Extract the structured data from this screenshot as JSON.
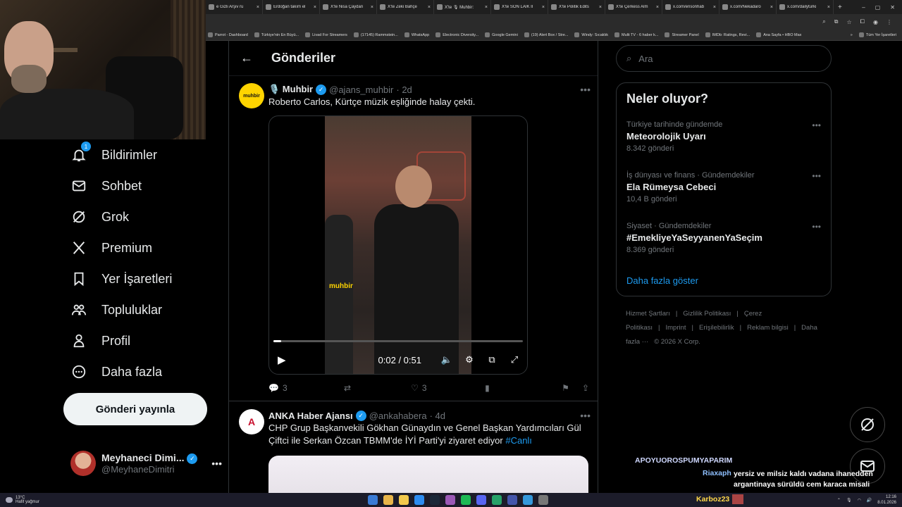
{
  "browser": {
    "tabs": [
      {
        "label": "e Gizli Arşiv ru"
      },
      {
        "label": "Erdoğan takım el"
      },
      {
        "label": "X'te Nisa Çaydan"
      },
      {
        "label": "X'te Zeki Bahçe"
      },
      {
        "label": "X'te 🎙 Muhbir:"
      },
      {
        "label": "X'te SON LAİK İl"
      },
      {
        "label": "X'te Politik Edits"
      },
      {
        "label": "X'te Çerkess Alm"
      },
      {
        "label": "x.com/ensonhab"
      },
      {
        "label": "x.com/Nekadaro"
      },
      {
        "label": "x.com/dailyturki"
      }
    ],
    "tab_close": "×",
    "new_tab": "+",
    "window_controls": [
      "–",
      "▢",
      "✕"
    ],
    "bookmarks": [
      "Parrot - Dashboard",
      "Türkiye'nin En Büyü...",
      "Livad For Streamers",
      "(17145) Rammstein...",
      "WhatsApp",
      "Electronic Diversity...",
      "Google Gemini",
      "(19) Alert Box / Stre...",
      "Windy: Sıcaklık",
      "Multi TV - 6 haber k...",
      "Streamer Panel",
      "IMDb: Ratings, Revi...",
      "Ana Sayfa • HBO Max"
    ],
    "bookmarks_more": "»",
    "bookmarks_all": "Tüm Yer İşaretleri"
  },
  "sidebar": {
    "items": [
      {
        "label": "Bildirimler",
        "icon": "bell-icon",
        "badge": "1"
      },
      {
        "label": "Sohbet",
        "icon": "mail-icon"
      },
      {
        "label": "Grok",
        "icon": "grok-icon"
      },
      {
        "label": "Premium",
        "icon": "x-logo-icon"
      },
      {
        "label": "Yer İşaretleri",
        "icon": "bookmark-icon"
      },
      {
        "label": "Topluluklar",
        "icon": "communities-icon"
      },
      {
        "label": "Profil",
        "icon": "profile-icon"
      },
      {
        "label": "Daha fazla",
        "icon": "more-circle-icon"
      }
    ],
    "post_button": "Gönderi yayınla",
    "account": {
      "name": "Meyhaneci Dimi...",
      "handle": "@MeyhaneDimitri",
      "more": "•••"
    }
  },
  "main": {
    "back": "←",
    "title": "Gönderiler",
    "posts": [
      {
        "name": "🎙️ Muhbir",
        "handle": "@ajans_muhbir",
        "time": "· 2d",
        "text": "Roberto Carlos, Kürtçe müzik eşliğinde halay çekti.",
        "avatar_text": "muhbir",
        "video": {
          "time": "0:02 / 0:51",
          "watermark": "muhbir",
          "progress": 0.03
        },
        "actions": {
          "replies": "3",
          "reposts": "",
          "likes": "3"
        }
      },
      {
        "name": "ANKA Haber Ajansı",
        "handle": "@ankahabera",
        "time": "· 4d",
        "text": "CHP Grup Başkanvekili Gökhan Günaydın ve Genel Başkan Yardımcıları Gül Çiftci ile Serkan Özcan TBMM'de İYİ Parti'yi ziyaret ediyor",
        "hashtag": "#Canlı",
        "avatar_text": "A"
      }
    ],
    "more": "•••"
  },
  "right": {
    "search_placeholder": "Ara",
    "trends_title": "Neler oluyor?",
    "trends": [
      {
        "context": "Türkiye tarihinde gündemde",
        "name": "Meteorolojik Uyarı",
        "posts": "8.342 gönderi"
      },
      {
        "context": "İş dünyası ve finans · Gündemdekiler",
        "name": "Ela Rümeysa Cebeci",
        "posts": "10,4 B gönderi"
      },
      {
        "context": "Siyaset · Gündemdekiler",
        "name": "#EmekliyeYaSeyyanenYaSeçim",
        "posts": "8.369 gönderi"
      }
    ],
    "show_more": "Daha fazla göster",
    "footer": [
      "Hizmet Şartları",
      "|",
      "Gizlilik Politikası",
      "|",
      "Çerez Politikası",
      "|",
      "Imprint",
      "|",
      "Erişilebilirlik",
      "|",
      "Reklam bilgisi",
      "|",
      "Daha fazla ···",
      "© 2026 X Corp."
    ]
  },
  "chat": [
    {
      "user": "APOYUOROSPUMYAPARIM",
      "message": ""
    },
    {
      "user": "Riaxaph",
      "message": "yersiz ve milsiz kaldı vadana ihanedden argantinaya sürüldü cem karaca misali"
    },
    {
      "user": "Karboz23",
      "message": ""
    }
  ],
  "taskbar": {
    "temp": "13°C",
    "condition": "Hafif yağmur",
    "time": "12:16",
    "date": "8.01.2026"
  }
}
